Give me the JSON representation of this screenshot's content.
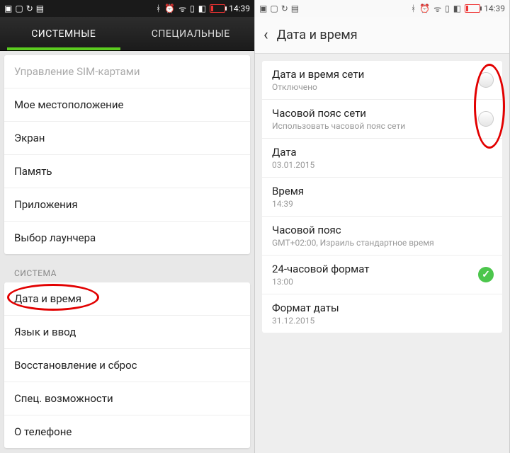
{
  "status": {
    "time": "14:39",
    "icons_left": [
      "add-icon",
      "image-icon",
      "refresh-icon",
      "sim-icon"
    ],
    "icons_right": [
      "bluetooth-icon",
      "alarm-icon",
      "wifi-icon",
      "signal-icon",
      "data-icon",
      "battery-icon"
    ]
  },
  "left": {
    "tabs": [
      "СИСТЕМНЫЕ",
      "СПЕЦИАЛЬНЫЕ"
    ],
    "active_tab": 0,
    "group1": [
      {
        "label": "Управление SIM-картами",
        "disabled": true
      },
      {
        "label": "Мое местоположение"
      },
      {
        "label": "Экран"
      },
      {
        "label": "Память"
      },
      {
        "label": "Приложения"
      },
      {
        "label": "Выбор лаунчера"
      }
    ],
    "section_title": "СИСТЕМА",
    "group2": [
      {
        "label": "Дата и время",
        "highlight": true
      },
      {
        "label": "Язык и ввод"
      },
      {
        "label": "Восстановление и сброс"
      },
      {
        "label": "Спец. возможности"
      },
      {
        "label": "О телефоне"
      }
    ]
  },
  "right": {
    "title": "Дата и время",
    "items": [
      {
        "main": "Дата и время сети",
        "sub": "Отключено",
        "toggle": "off",
        "highlight": true
      },
      {
        "main": "Часовой пояс сети",
        "sub": "Использовать часовой пояс сети",
        "toggle": "off",
        "highlight": true
      },
      {
        "main": "Дата",
        "sub": "03.01.2015"
      },
      {
        "main": "Время",
        "sub": "14:39"
      },
      {
        "main": "Часовой пояс",
        "sub": "GMT+02:00, Израиль стандартное время"
      },
      {
        "main": "24-часовой формат",
        "sub": "13:00",
        "toggle": "on"
      },
      {
        "main": "Формат даты",
        "sub": "31.12.2015"
      }
    ]
  }
}
